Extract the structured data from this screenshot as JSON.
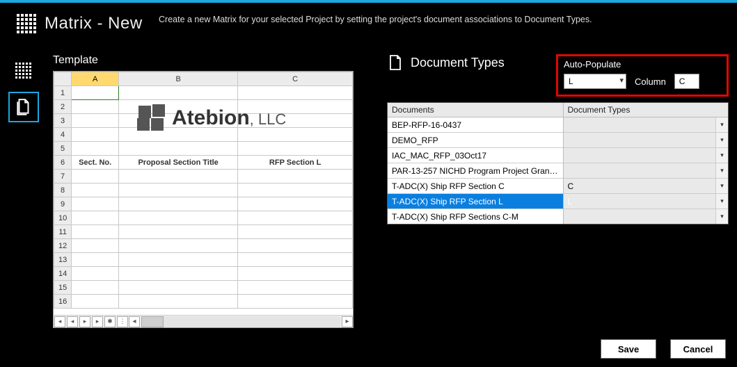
{
  "header": {
    "title": "Matrix - New",
    "description": "Create a new Matrix for your selected Project by setting the project's document associations to Document Types."
  },
  "panel_left": {
    "title": "Template",
    "columns": [
      "A",
      "B",
      "C"
    ],
    "row_count": 16,
    "row6_headers": {
      "A": "Sect. No.",
      "B": "Proposal Section Title",
      "C": "RFP Section L"
    },
    "logo_text_main": "Atebion",
    "logo_text_suffix": ", LLC"
  },
  "panel_right": {
    "title": "Document Types",
    "autopop": {
      "title": "Auto-Populate",
      "select_value": "L",
      "column_label": "Column",
      "column_value": "C"
    },
    "columns": {
      "docs": "Documents",
      "types": "Document Types"
    },
    "rows": [
      {
        "doc": "BEP-RFP-16-0437",
        "type": "",
        "selected": false
      },
      {
        "doc": "DEMO_RFP",
        "type": "",
        "selected": false
      },
      {
        "doc": "IAC_MAC_RFP_03Oct17",
        "type": "",
        "selected": false
      },
      {
        "doc": "PAR-13-257  NICHD Program Project Grant ...",
        "type": "",
        "selected": false
      },
      {
        "doc": "T-ADC(X) Ship RFP Section C",
        "type": "C",
        "selected": false
      },
      {
        "doc": "T-ADC(X) Ship RFP Section L",
        "type": "L",
        "selected": true
      },
      {
        "doc": "T-ADC(X) Ship RFP Sections C-M",
        "type": "",
        "selected": false
      }
    ]
  },
  "footer": {
    "save": "Save",
    "cancel": "Cancel"
  }
}
